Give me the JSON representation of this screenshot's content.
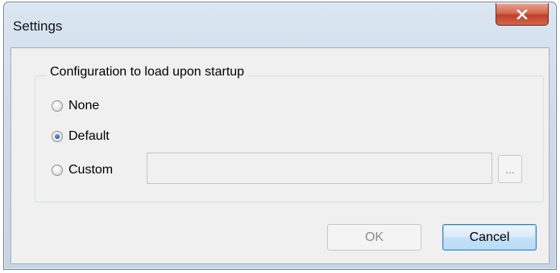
{
  "window": {
    "title": "Settings"
  },
  "group": {
    "title": "Configuration to load upon startup"
  },
  "options": [
    {
      "label": "None",
      "checked": false
    },
    {
      "label": "Default",
      "checked": true
    },
    {
      "label": "Custom",
      "checked": false
    }
  ],
  "custom_path": {
    "value": "",
    "enabled": false
  },
  "browse_button": {
    "label": "..."
  },
  "buttons": {
    "ok_label": "OK",
    "ok_enabled": false,
    "cancel_label": "Cancel"
  },
  "icons": {
    "close": "close-icon"
  }
}
